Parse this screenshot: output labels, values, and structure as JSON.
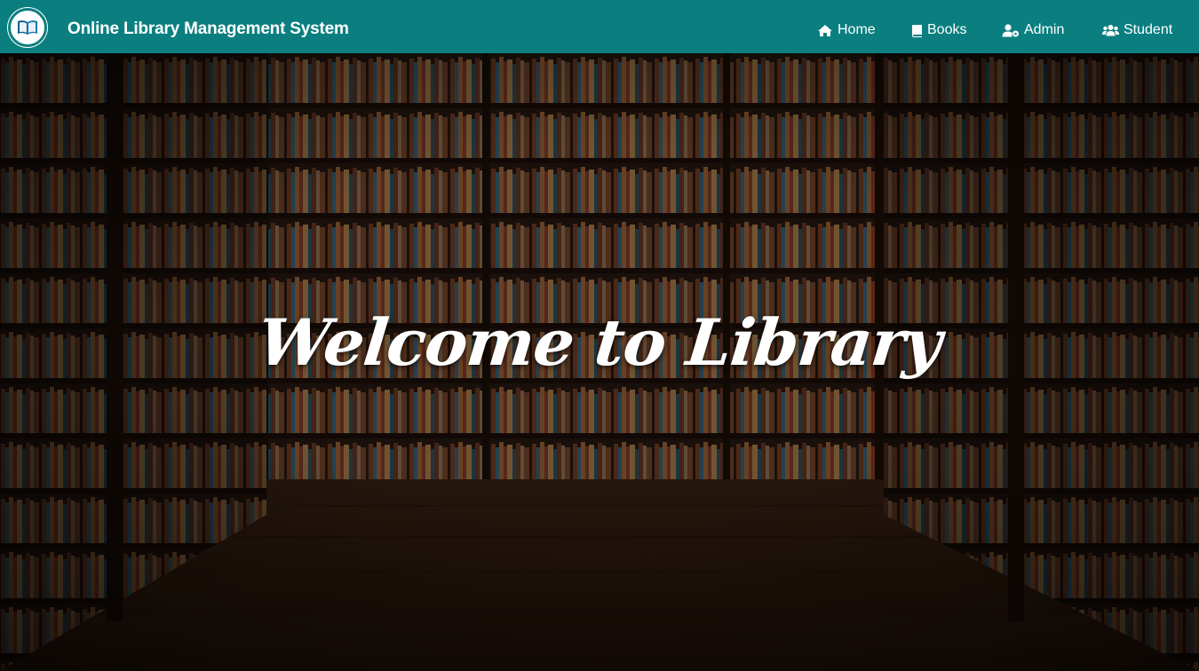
{
  "navbar": {
    "brand": "Online Library Management System",
    "logo_icon": "open-book-icon",
    "items": [
      {
        "label": "Home",
        "icon": "home-icon"
      },
      {
        "label": "Books",
        "icon": "book-icon"
      },
      {
        "label": "Admin",
        "icon": "admin-user-icon"
      },
      {
        "label": "Student",
        "icon": "users-icon"
      }
    ]
  },
  "hero": {
    "headline": "Welcome to Library"
  },
  "colors": {
    "navbar": "#0b7f80",
    "text": "#ffffff"
  }
}
